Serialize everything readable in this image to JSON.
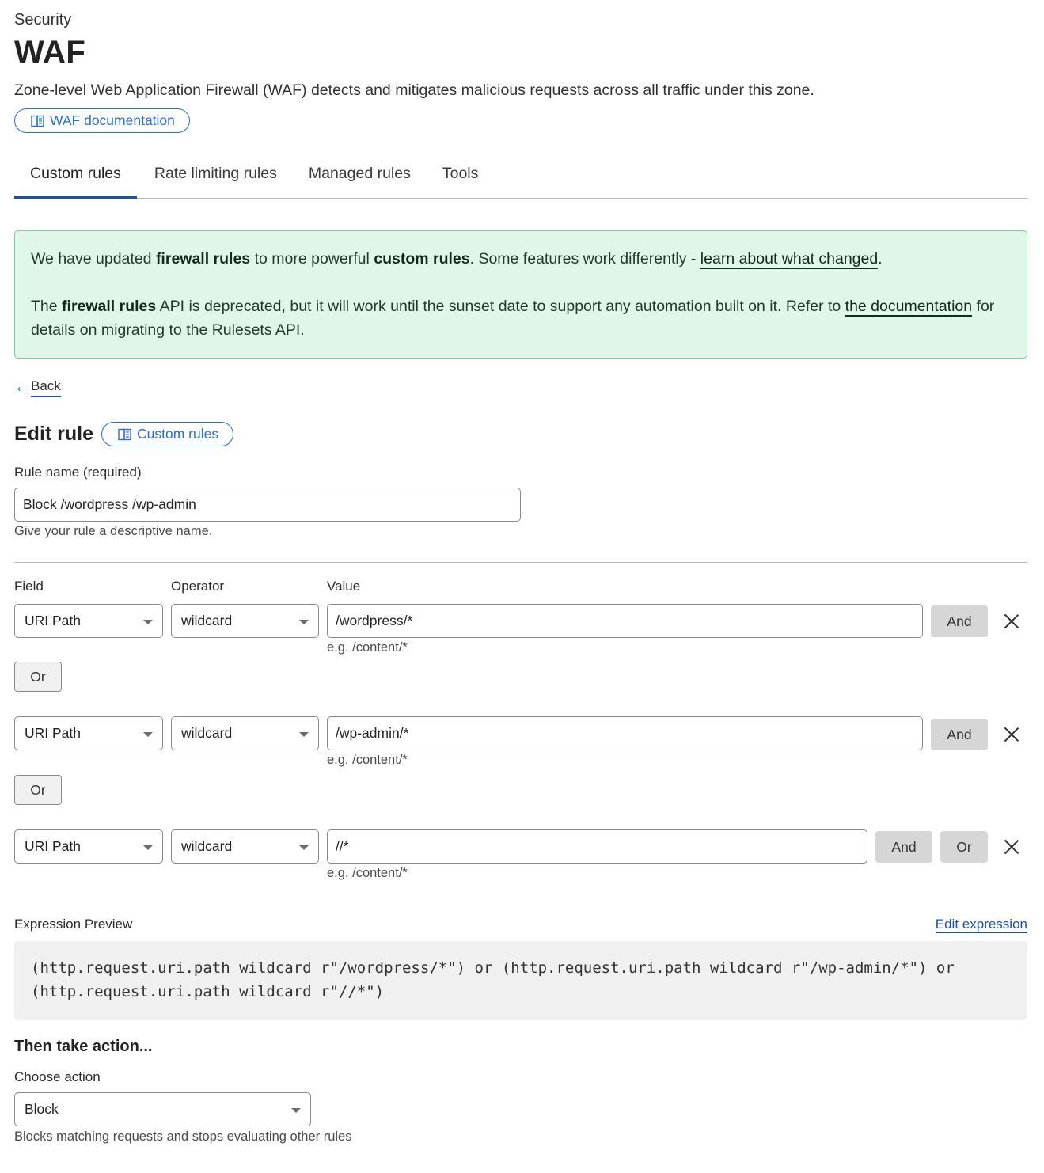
{
  "header": {
    "breadcrumb": "Security",
    "title": "WAF",
    "description": "Zone-level Web Application Firewall (WAF) detects and mitigates malicious requests across all traffic under this zone.",
    "doc_link": "WAF documentation"
  },
  "tabs": [
    {
      "label": "Custom rules",
      "active": true
    },
    {
      "label": "Rate limiting rules",
      "active": false
    },
    {
      "label": "Managed rules",
      "active": false
    },
    {
      "label": "Tools",
      "active": false
    }
  ],
  "banner": {
    "line1_pre": "We have updated ",
    "line1_b1": "firewall rules",
    "line1_mid": " to more powerful ",
    "line1_b2": "custom rules",
    "line1_post": ". Some features work differently - ",
    "line1_link": "learn about what changed",
    "line1_end": ".",
    "line2_pre": "The ",
    "line2_b": "firewall rules",
    "line2_mid": " API is deprecated, but it will work until the sunset date to support any automation built on it. Refer to ",
    "line2_link": "the documentation",
    "line2_post": " for details on migrating to the Rulesets API.",
    "bg_color": "#e0f6e9",
    "border_color": "#6fd39a"
  },
  "back": {
    "arrow": "←",
    "label": "Back"
  },
  "edit": {
    "title": "Edit rule",
    "doc_link": "Custom rules",
    "rule_name_label": "Rule name (required)",
    "rule_name_value": "Block /wordpress /wp-admin",
    "rule_name_hint": "Give your rule a descriptive name."
  },
  "conditions": {
    "field_label": "Field",
    "operator_label": "Operator",
    "value_label": "Value",
    "rows": [
      {
        "field": "URI Path",
        "operator": "wildcard",
        "value": "/wordpress/*",
        "hint": "e.g. /content/*",
        "and": "And"
      },
      {
        "field": "URI Path",
        "operator": "wildcard",
        "value": "/wp-admin/*",
        "hint": "e.g. /content/*",
        "and": "And"
      },
      {
        "field": "URI Path",
        "operator": "wildcard",
        "value": "//*",
        "hint": "e.g. /content/*",
        "and": "And",
        "or": "Or"
      }
    ],
    "or_label": "Or"
  },
  "expression": {
    "label": "Expression Preview",
    "edit_link": "Edit expression",
    "text": "(http.request.uri.path wildcard r\"/wordpress/*\") or (http.request.uri.path wildcard r\"/wp-admin/*\") or\n(http.request.uri.path wildcard r\"//*\")"
  },
  "action": {
    "heading": "Then take action...",
    "label": "Choose action",
    "value": "Block",
    "hint": "Blocks matching requests and stops evaluating other rules"
  },
  "colors": {
    "accent": "#2c6ecb",
    "link": "#1d4fa8",
    "tab_indicator": "#1d4fa8",
    "button_gray": "#d6d6d6",
    "code_bg": "#f0f0f0"
  }
}
